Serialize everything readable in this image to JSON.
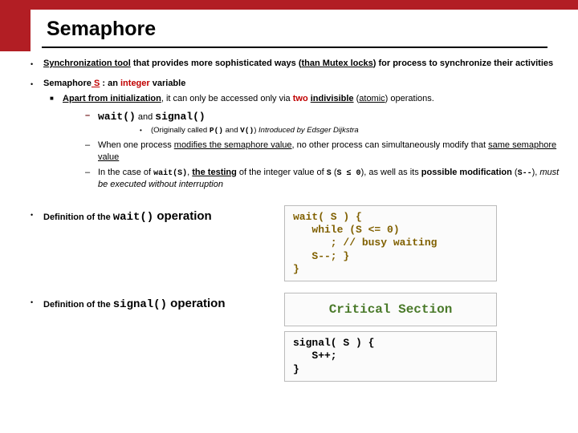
{
  "title": "Semaphore",
  "p1": {
    "l1a": "Synchronization tool",
    "l1b": " that provides more sophisticated ways (",
    "l1c": "than Mutex locks",
    "l1d": ")  for process to synchronize their activities"
  },
  "p2": {
    "l1a": "Semaphore",
    "l1b": " S",
    "l1c": "  :  an ",
    "l1d": "integer",
    "l1e": " variable",
    "s1a": "Apart from initialization",
    "s1b": ", it can only be accessed only via ",
    "s1c": "two",
    "s1d": " ",
    "s1e": "indivisible",
    "s1f": " (",
    "s1g": "atomic",
    "s1h": ") operations.",
    "ops_wait": "wait()",
    "ops_and": " and ",
    "ops_signal": "signal()",
    "orig_a": "(Originally called ",
    "orig_p": "P()",
    "orig_b": " and ",
    "orig_v": "V()",
    "orig_c": ") ",
    "orig_d": "Introduced by Edsger Dijkstra",
    "n1a": "When one process ",
    "n1b": "modifies the semaphore value",
    "n1c": ", no other process can simultaneously modify that ",
    "n1d": "same semaphore value",
    "n2a": "In the case of ",
    "n2b": "wait(S)",
    "n2c": ", ",
    "n2d": "the testing",
    "n2e": " of the integer value of ",
    "n2f": "S",
    "n2g": " (",
    "n2h": "S  ≤  0",
    "n2i": "), as well as its ",
    "n2j": "possible modification",
    "n2k": " (",
    "n2l": "S--",
    "n2m": "), ",
    "n2n": "must be executed without interruption"
  },
  "def_wait_label_a": "Definition of  the ",
  "def_wait_op": "wait()",
  "def_wait_label_b": " operation",
  "def_signal_label_a": "Definition of  the ",
  "def_signal_op": "signal()",
  "def_signal_label_b": " operation",
  "code_wait": "wait( S ) {\n   while (S <= 0)\n      ; // busy waiting\n   S--; }\n}",
  "code_cs": "Critical Section",
  "code_signal": "signal( S ) {\n   S++;\n}"
}
